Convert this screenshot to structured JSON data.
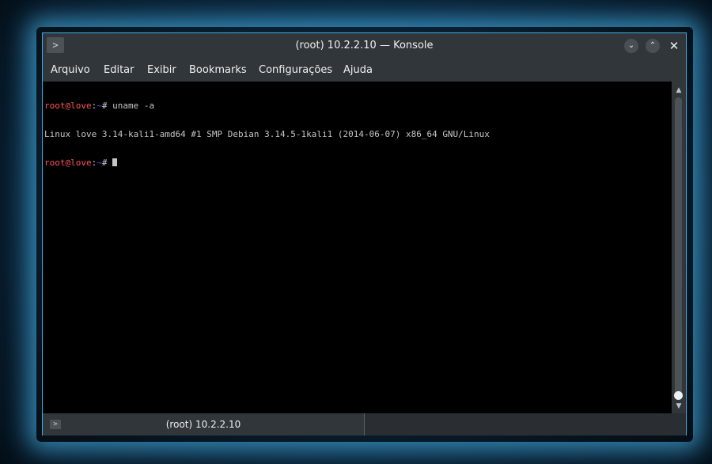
{
  "window": {
    "title": "(root) 10.2.2.10 — Konsole",
    "app_icon_glyph": ">",
    "minimize_glyph": "⌄",
    "maximize_glyph": "⌃",
    "close_glyph": "✕"
  },
  "menu": {
    "items": [
      "Arquivo",
      "Editar",
      "Exibir",
      "Bookmarks",
      "Configurações",
      "Ajuda"
    ]
  },
  "terminal": {
    "lines": [
      {
        "user_host": "root@love",
        "sep": ":",
        "path": "~",
        "symbol": "# ",
        "command": "uname -a"
      },
      {
        "output": "Linux love 3.14-kali1-amd64 #1 SMP Debian 3.14.5-1kali1 (2014-06-07) x86_64 GNU/Linux"
      },
      {
        "user_host": "root@love",
        "sep": ":",
        "path": "~",
        "symbol": "# ",
        "command": ""
      }
    ]
  },
  "scrollbar": {
    "up_glyph": "▲",
    "down_glyph": "▼",
    "position_fraction": 1.0
  },
  "tabs": [
    {
      "label": "(root) 10.2.2.10",
      "icon_glyph": ">"
    }
  ],
  "colors": {
    "prompt_user": "#ff5454",
    "prompt_path": "#5454ff",
    "terminal_bg": "#000000",
    "window_bg": "#31363b",
    "accent": "#3daee9"
  }
}
